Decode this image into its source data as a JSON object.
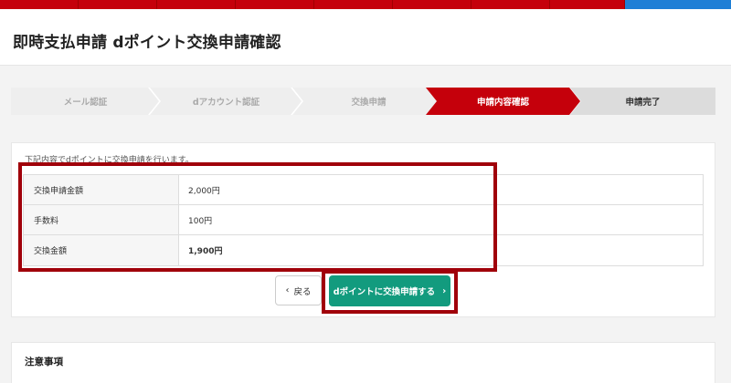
{
  "colors": {
    "brand_red": "#c5000b",
    "highlight_red": "#a0000a",
    "primary_green": "#129b7e",
    "topbar_blue": "#1e7fd6"
  },
  "header": {
    "title": "即時支払申請 dポイント交換申請確認"
  },
  "steps": [
    {
      "label": "メール認証",
      "state": "done"
    },
    {
      "label": "dアカウント認証",
      "state": "done"
    },
    {
      "label": "交換申請",
      "state": "done"
    },
    {
      "label": "申請内容確認",
      "state": "active"
    },
    {
      "label": "申請完了",
      "state": "future"
    }
  ],
  "confirm": {
    "intro": "下記内容でdポイントに交換申請を行います。",
    "rows": [
      {
        "label": "交換申請金額",
        "value": "2,000円"
      },
      {
        "label": "手数料",
        "value": "100円"
      },
      {
        "label": "交換金額",
        "value": "1,900円"
      }
    ]
  },
  "buttons": {
    "back_label": "戻る",
    "back_icon": "chevron-left-icon",
    "submit_label": "dポイントに交換申請する",
    "submit_icon": "chevron-right-icon"
  },
  "notes": {
    "title": "注意事項"
  }
}
